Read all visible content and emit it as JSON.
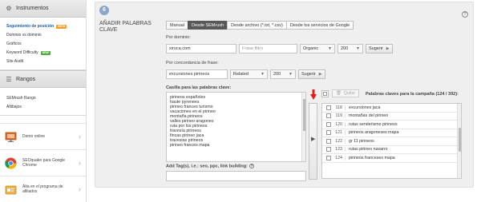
{
  "sidebar": {
    "instrumentos": {
      "title": "Instrumentos",
      "items": [
        {
          "label": "Seguimiento de posición",
          "badge": "BETA",
          "active": true
        },
        {
          "label": "Dominio vs dominio"
        },
        {
          "label": "Gráficos"
        },
        {
          "label": "Keyword Difficulty",
          "badge": "NEW"
        },
        {
          "label": "Site Audit"
        }
      ]
    },
    "rangos": {
      "title": "Rangos",
      "items": [
        {
          "label": "SEMrush Rango"
        },
        {
          "label": "Altibajos"
        }
      ]
    },
    "promos": [
      {
        "label": "Demo online",
        "icon": "monitor-icon"
      },
      {
        "label": "SEOquake para Google Chrome",
        "icon": "chrome-icon"
      },
      {
        "label": "Alta en el programa de afiliados",
        "icon": "affiliate-icon"
      }
    ]
  },
  "panel": {
    "step_number": "6",
    "title": "AÑADIR PALABRAS CLAVE",
    "help": "?",
    "tabs": [
      {
        "label": "Manual",
        "active": false
      },
      {
        "label": "Desde SEMrush",
        "active": true
      },
      {
        "label": "Desde archivo (*.txt, *.csv)",
        "active": false
      },
      {
        "label": "Desde los servicios de Google",
        "active": false
      }
    ],
    "by_domain": {
      "label": "Por dominio:",
      "domain_value": "xiruca.com",
      "phrase_placeholder": "Frase filtro",
      "type_value": "Organic",
      "count_value": "200",
      "suggest_label": "Sugerir"
    },
    "by_phrase": {
      "label": "Por concordancia de frase:",
      "phrase_value": "excursiones pirineos",
      "match_value": "Related",
      "count_value": "200",
      "suggest_label": "Sugerir"
    },
    "keyword_box": {
      "label": "Casilla para las palabras clave:",
      "keywords": [
        "pirineos españoles",
        "haute pyrenees",
        "pirineo frances turismo",
        "vacaciones en el pirineo",
        "montaña pirineos",
        "valles pirineo aragones",
        "ruta por los pirineos",
        "travesía pirineos",
        "fincas pirineo jaca",
        "travesias pirineos",
        "pirineo francés mapa"
      ]
    },
    "tags": {
      "label": "Add Tag(s), i.e.: seo, ppc, link building:",
      "help": "?"
    },
    "remove_label": "Quitar",
    "campaign": {
      "label": "Palabras claves para la campaña (124 / 392):",
      "rows": [
        {
          "num": "118",
          "keyword": "excursiones jaca"
        },
        {
          "num": "119",
          "keyword": "montañas del pirineo"
        },
        {
          "num": "120",
          "keyword": "rutas senderismo pirineos"
        },
        {
          "num": "121",
          "keyword": "pirineos aragoneses mapa"
        },
        {
          "num": "122",
          "keyword": "gr 11 pirineos"
        },
        {
          "num": "123",
          "keyword": "rutas pirineo navarro"
        },
        {
          "num": "124",
          "keyword": "pirineos franceses mapa"
        }
      ]
    }
  },
  "colors": {
    "active_link": "#1f5fa8",
    "active_tab": "#585858",
    "step_circle": "#8aa7c7",
    "arrow_red": "#e02020"
  }
}
